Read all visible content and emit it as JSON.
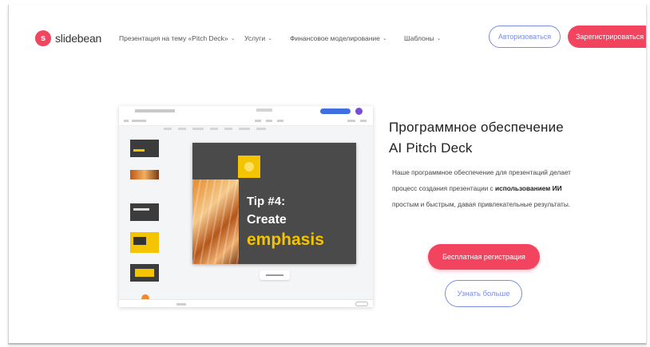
{
  "brand": {
    "logo_letter": "s",
    "name": "slidebean",
    "accent": "#f3445f",
    "outline": "#7a8ee0"
  },
  "nav": {
    "items": [
      {
        "label": "Презентация на тему «Pitch Deck»"
      },
      {
        "label": "Услуги"
      },
      {
        "label": "Финансовое моделирование"
      },
      {
        "label": "Шаблоны"
      }
    ],
    "chevron": "⌄",
    "login_label": "Авторизоваться",
    "signup_label": "Зарегистрироваться"
  },
  "preview": {
    "slide_tip": "Tip #4:",
    "slide_create": "Create",
    "slide_emphasis": "emphasis"
  },
  "hero": {
    "title_line1": "Программное обеспечение",
    "title_line2": "AI Pitch Deck",
    "desc_part1": "Наше программное обеспечение для презентаций делает процесс создания презентации с",
    "desc_bold": "использованием ИИ",
    "desc_part2": "простым и быстрым, давая привлекательные результаты.",
    "primary_cta": "Бесплатная регистрация",
    "secondary_cta": "Узнать больше"
  }
}
